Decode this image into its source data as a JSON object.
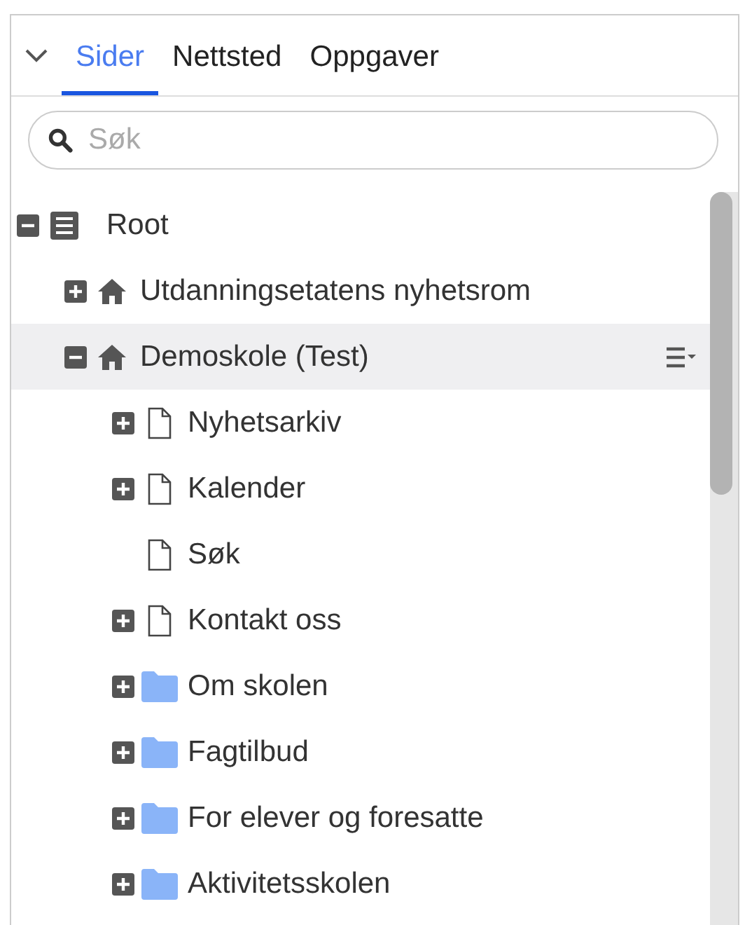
{
  "tabs": [
    {
      "label": "Sider",
      "selected": true
    },
    {
      "label": "Nettsted",
      "selected": false
    },
    {
      "label": "Oppgaver",
      "selected": false
    }
  ],
  "search": {
    "placeholder": "Søk"
  },
  "tree": [
    {
      "label": "Root",
      "kind": "root",
      "expanded": true,
      "selected": false,
      "children": [
        {
          "label": "Utdanningsetatens nyhetsrom",
          "kind": "site",
          "expanded": false,
          "selected": false
        },
        {
          "label": "Demoskole (Test)",
          "kind": "site",
          "expanded": true,
          "selected": true,
          "children": [
            {
              "label": "Nyhetsarkiv",
              "kind": "page",
              "expanded": false,
              "selected": false
            },
            {
              "label": "Kalender",
              "kind": "page",
              "expanded": false,
              "selected": false
            },
            {
              "label": "Søk",
              "kind": "page",
              "selected": false
            },
            {
              "label": "Kontakt oss",
              "kind": "page",
              "expanded": false,
              "selected": false
            },
            {
              "label": "Om skolen",
              "kind": "folder",
              "expanded": false,
              "selected": false
            },
            {
              "label": "Fagtilbud",
              "kind": "folder",
              "expanded": false,
              "selected": false
            },
            {
              "label": "For elever og foresatte",
              "kind": "folder",
              "expanded": false,
              "selected": false
            },
            {
              "label": "Aktivitetsskolen",
              "kind": "folder",
              "expanded": false,
              "selected": false
            }
          ]
        }
      ]
    }
  ]
}
